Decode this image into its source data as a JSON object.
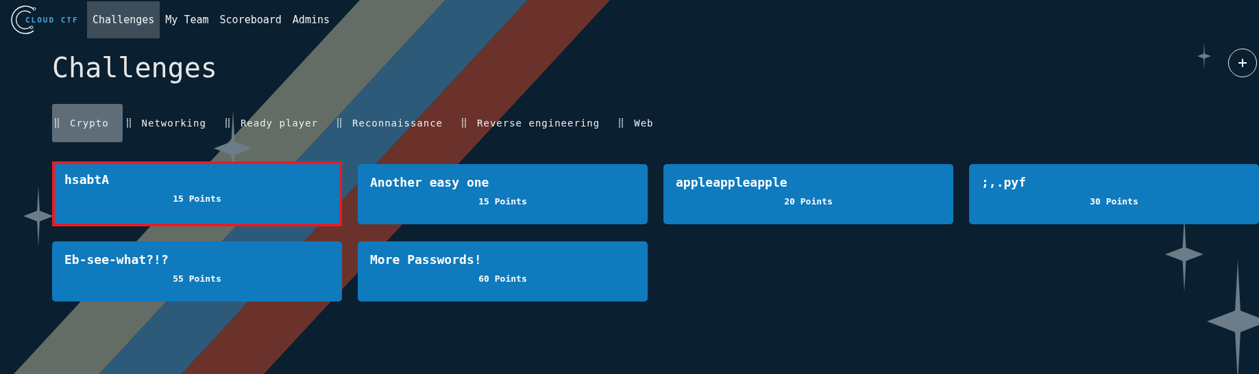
{
  "navbar": {
    "logo_text": "CLOUD CTF",
    "items": [
      {
        "label": "Challenges",
        "selected": true
      },
      {
        "label": "My Team",
        "selected": false
      },
      {
        "label": "Scoreboard",
        "selected": false
      },
      {
        "label": "Admins",
        "selected": false
      }
    ]
  },
  "page_title": "Challenges",
  "categories": [
    {
      "label": "Crypto",
      "selected": true
    },
    {
      "label": "Networking",
      "selected": false
    },
    {
      "label": "Ready player",
      "selected": false
    },
    {
      "label": "Reconnaissance",
      "selected": false
    },
    {
      "label": "Reverse engineering",
      "selected": false
    },
    {
      "label": "Web",
      "selected": false
    }
  ],
  "challenges": [
    {
      "title": "hsabtA",
      "points": "15 Points",
      "selected": true
    },
    {
      "title": "Another easy one",
      "points": "15 Points",
      "selected": false
    },
    {
      "title": "appleappleapple",
      "points": "20 Points",
      "selected": false
    },
    {
      "title": ";,.pyf",
      "points": "30 Points",
      "selected": false
    },
    {
      "title": "Eb-see-what?!?",
      "points": "55 Points",
      "selected": false
    },
    {
      "title": "More Passwords!",
      "points": "60 Points",
      "selected": false
    }
  ]
}
